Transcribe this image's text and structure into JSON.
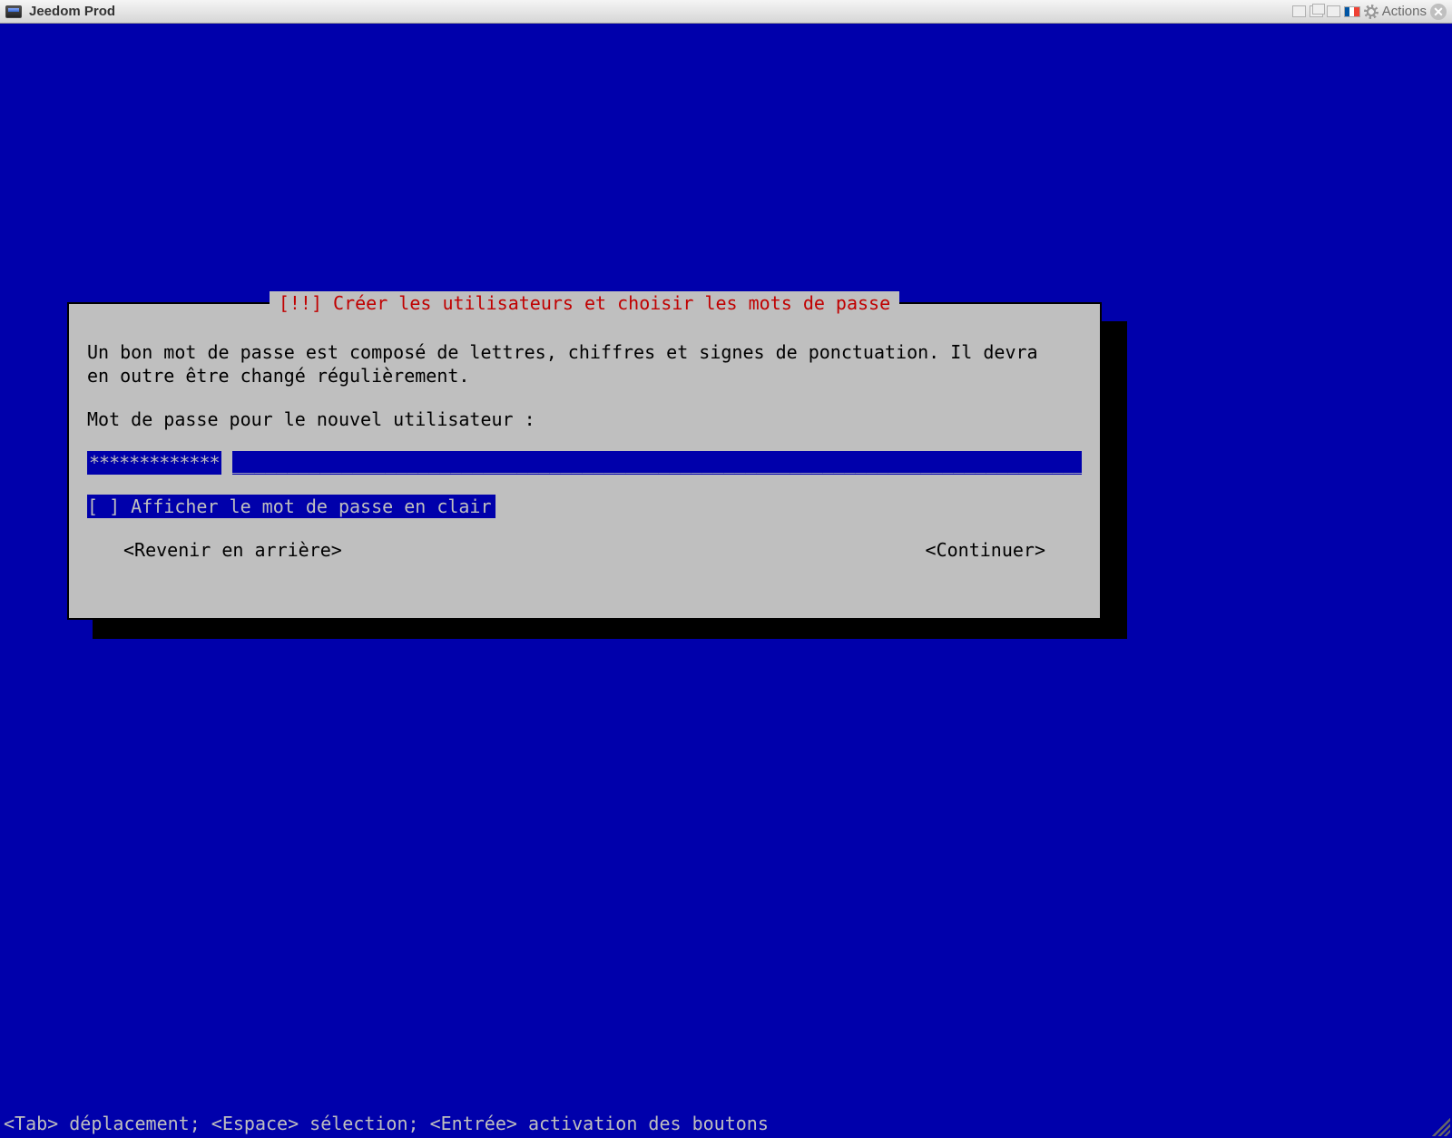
{
  "window": {
    "title": "Jeedom Prod",
    "actions_label": "Actions"
  },
  "installer": {
    "dialog_title": "[!!] Créer les utilisateurs et choisir les mots de passe",
    "description": "Un bon mot de passe est composé de lettres, chiffres et signes de ponctuation. Il devra\nen outre être changé régulièrement.",
    "prompt": "Mot de passe pour le nouvel utilisateur :",
    "password_masked": "*************",
    "show_password_checkbox": "[ ] Afficher le mot de passe en clair",
    "back_button": "<Revenir en arrière>",
    "continue_button": "<Continuer>"
  },
  "help_line": "<Tab> déplacement; <Espace> sélection; <Entrée> activation des boutons"
}
